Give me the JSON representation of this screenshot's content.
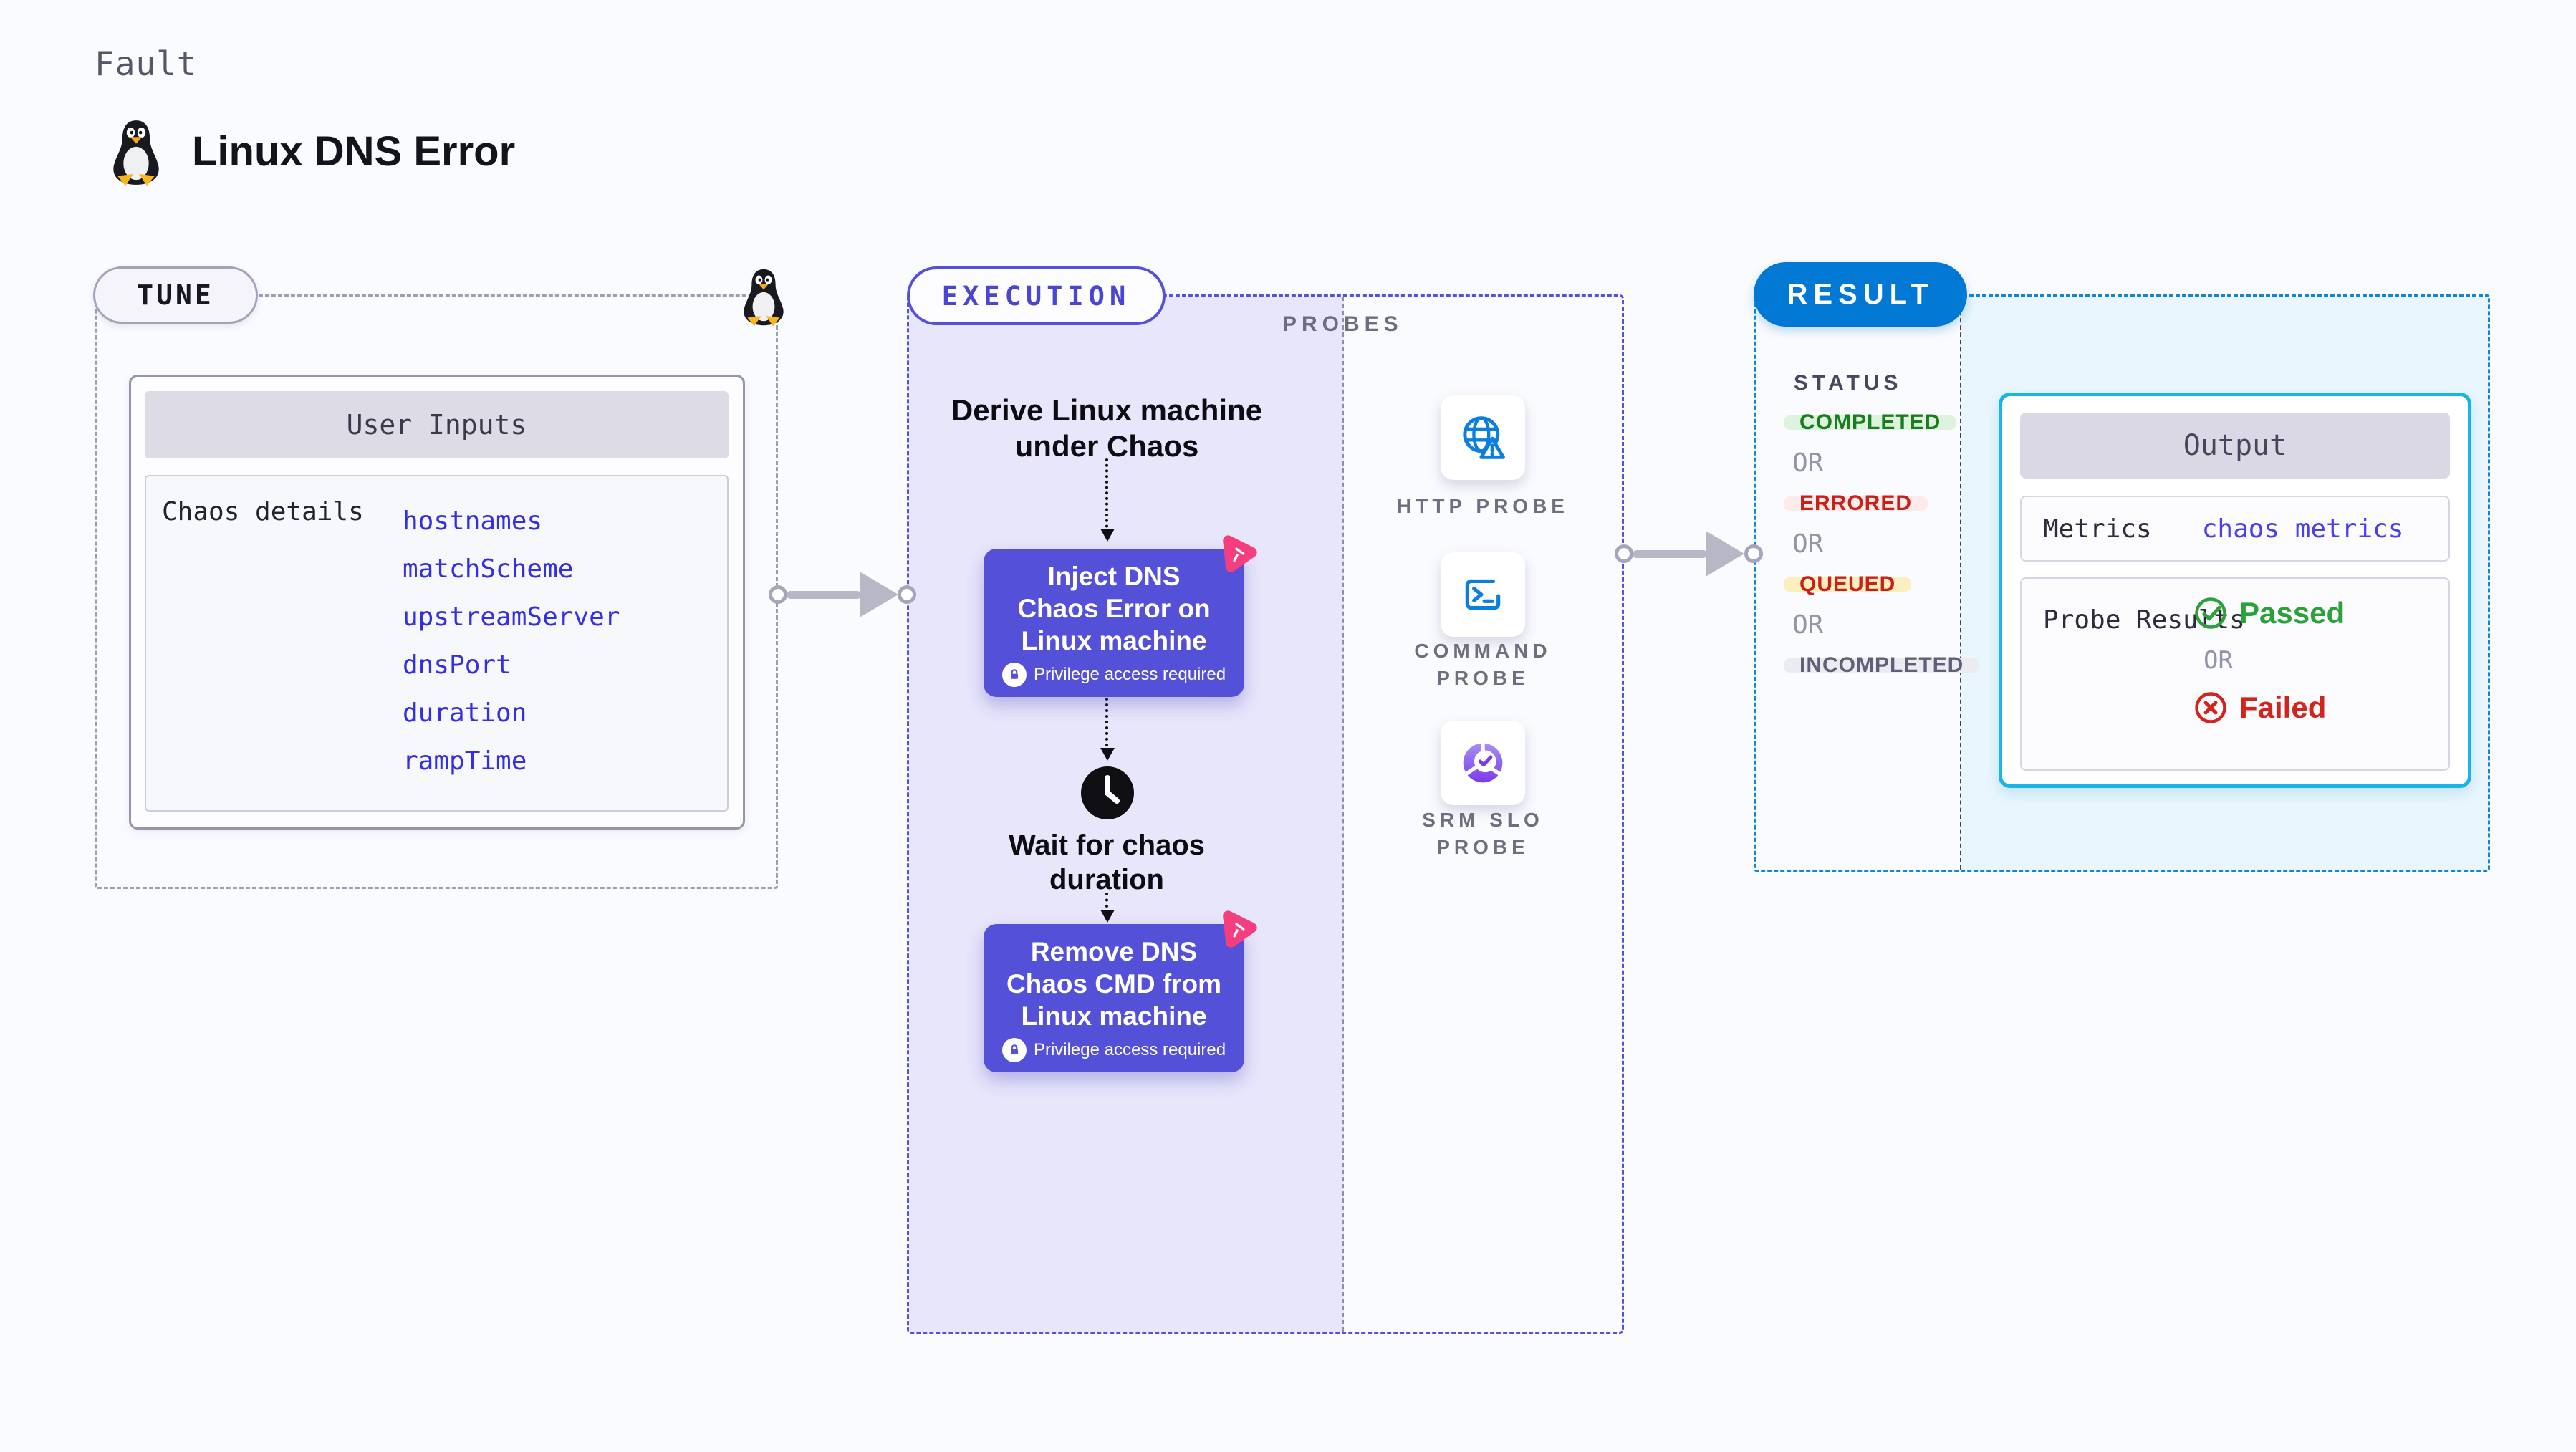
{
  "header": {
    "kicker": "Fault",
    "title": "Linux DNS Error"
  },
  "tune": {
    "pill": "TUNE",
    "card_title": "User Inputs",
    "row_label": "Chaos details",
    "params": [
      "hostnames",
      "matchScheme",
      "upstreamServer",
      "dnsPort",
      "duration",
      "rampTime"
    ]
  },
  "execution": {
    "pill": "EXECUTION",
    "derive_title": "Derive Linux machine under Chaos",
    "inject_label": "Inject DNS Chaos Error on Linux machine",
    "wait_title": "Wait for chaos duration",
    "remove_label": "Remove DNS Chaos CMD from Linux machine",
    "privilege_note": "Privilege access required"
  },
  "probes": {
    "label": "PROBES",
    "items": [
      {
        "name": "HTTP PROBE",
        "icon": "globe-warning-icon"
      },
      {
        "name": "COMMAND PROBE",
        "icon": "terminal-icon"
      },
      {
        "name": "SRM SLO PROBE",
        "icon": "slo-donut-check-icon"
      }
    ]
  },
  "result": {
    "pill": "RESULT",
    "status_label": "STATUS",
    "or_label": "OR",
    "statuses": [
      {
        "label": "COMPLETED",
        "bg": "#ddf3dd",
        "fg": "#1a7d1e"
      },
      {
        "label": "ERRORED",
        "bg": "#fcebe9",
        "fg": "#c9201a"
      },
      {
        "label": "QUEUED",
        "bg": "#fbeebf",
        "fg": "#c9201a"
      },
      {
        "label": "INCOMPLETED",
        "bg": "#ebecf2",
        "fg": "#5f6078"
      }
    ],
    "output": {
      "title": "Output",
      "metrics_label": "Metrics",
      "metrics_value": "chaos metrics",
      "probe_label": "Probe Results",
      "passed": "Passed",
      "failed": "Failed"
    }
  },
  "colors": {
    "indigo_accent": "#5450d8",
    "execution_fill": "#e8e6fb",
    "result_blue": "#0278d5",
    "output_border": "#17b5e9",
    "param_blue": "#342fe4",
    "passed_green": "#2aa13b",
    "failed_red": "#d2241c",
    "chaos_pink": "#f43e7d"
  }
}
